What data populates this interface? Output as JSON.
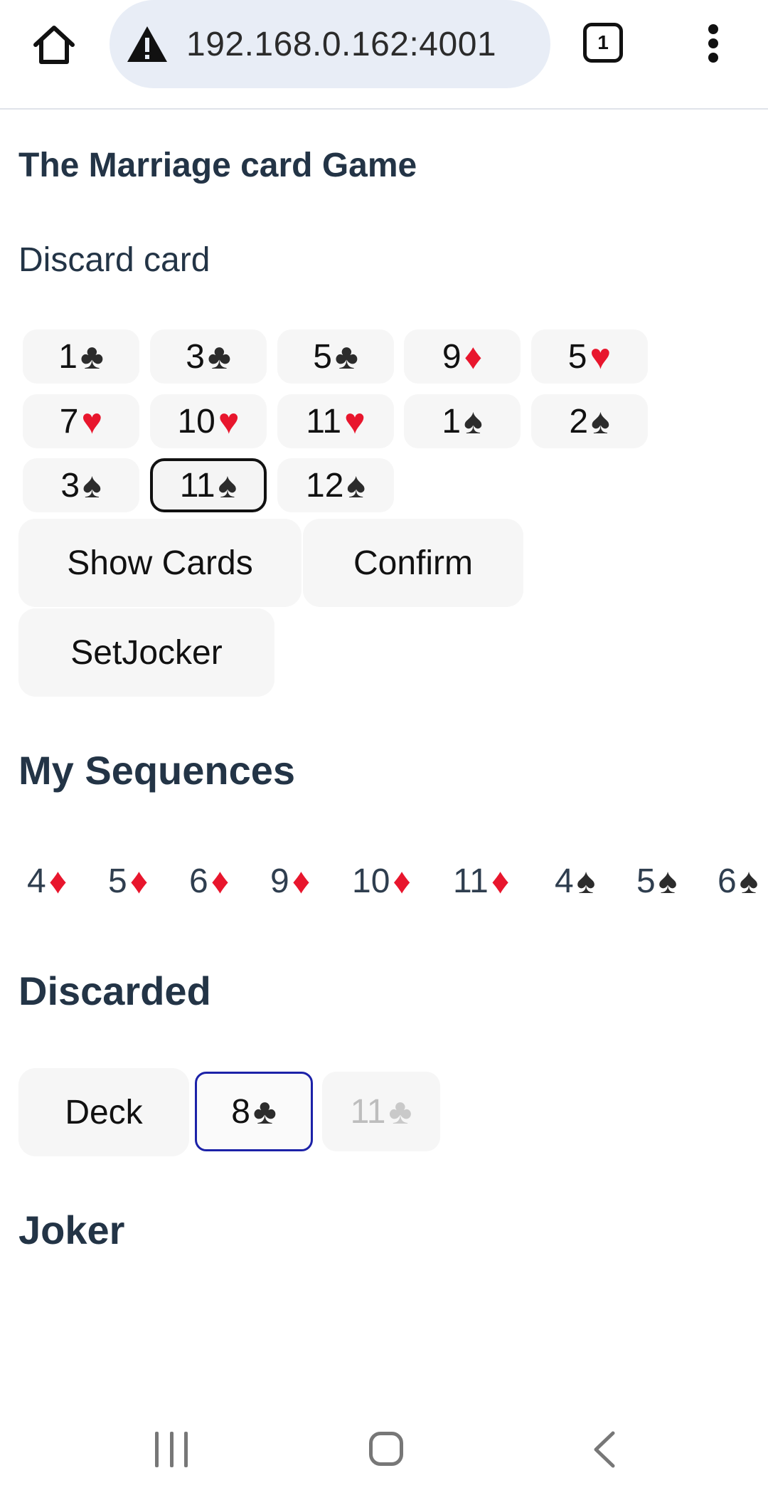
{
  "browser": {
    "url": "192.168.0.162:4001",
    "tab_count": "1"
  },
  "page": {
    "title": "The Marriage card Game",
    "status": "Discard card"
  },
  "hand": [
    {
      "rank": "1",
      "suit": "♣",
      "color": "black"
    },
    {
      "rank": "3",
      "suit": "♣",
      "color": "black"
    },
    {
      "rank": "5",
      "suit": "♣",
      "color": "black"
    },
    {
      "rank": "9",
      "suit": "♦",
      "color": "red"
    },
    {
      "rank": "5",
      "suit": "♥",
      "color": "red"
    },
    {
      "rank": "7",
      "suit": "♥",
      "color": "red"
    },
    {
      "rank": "10",
      "suit": "♥",
      "color": "red"
    },
    {
      "rank": "11",
      "suit": "♥",
      "color": "red"
    },
    {
      "rank": "1",
      "suit": "♠",
      "color": "black"
    },
    {
      "rank": "2",
      "suit": "♠",
      "color": "black"
    },
    {
      "rank": "3",
      "suit": "♠",
      "color": "black"
    },
    {
      "rank": "11",
      "suit": "♠",
      "color": "black",
      "selected": true
    },
    {
      "rank": "12",
      "suit": "♠",
      "color": "black"
    }
  ],
  "buttons": {
    "show_cards": "Show Cards",
    "confirm": "Confirm",
    "set_joker": "SetJocker"
  },
  "sequences": {
    "heading": "My Sequences",
    "cards": [
      {
        "rank": "4",
        "suit": "♦",
        "color": "red"
      },
      {
        "rank": "5",
        "suit": "♦",
        "color": "red"
      },
      {
        "rank": "6",
        "suit": "♦",
        "color": "red"
      },
      {
        "rank": "9",
        "suit": "♦",
        "color": "red"
      },
      {
        "rank": "10",
        "suit": "♦",
        "color": "red"
      },
      {
        "rank": "11",
        "suit": "♦",
        "color": "red"
      },
      {
        "rank": "4",
        "suit": "♠",
        "color": "black"
      },
      {
        "rank": "5",
        "suit": "♠",
        "color": "black"
      },
      {
        "rank": "6",
        "suit": "♠",
        "color": "black"
      }
    ]
  },
  "discarded": {
    "heading": "Discarded",
    "deck_label": "Deck",
    "cards": [
      {
        "rank": "8",
        "suit": "♣",
        "color": "black",
        "state": "active"
      },
      {
        "rank": "11",
        "suit": "♣",
        "color": "black",
        "state": "disabled"
      }
    ]
  },
  "joker": {
    "heading": "Joker"
  },
  "colors": {
    "heading": "#233446",
    "card_bg": "#f6f6f6",
    "red_suit": "#e8162d",
    "active_border": "#1c22a8",
    "url_bar": "#e8edf6"
  }
}
